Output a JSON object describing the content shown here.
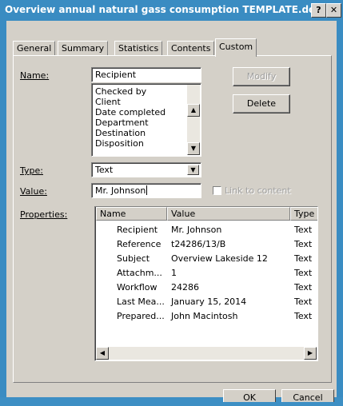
{
  "window": {
    "title": "Overview annual natural gass consumption TEMPLATE.do...",
    "help_glyph": "?",
    "close_glyph": "✕",
    "frame_color": "#3a8cc2"
  },
  "tabs": [
    "General",
    "Summary",
    "Statistics",
    "Contents",
    "Custom"
  ],
  "active_tab": "Custom",
  "form": {
    "name_label": "Name:",
    "name_value": "Recipient",
    "name_list": [
      "Checked by",
      "Client",
      "Date completed",
      "Department",
      "Destination",
      "Disposition"
    ],
    "type_label": "Type:",
    "type_value": "Text",
    "value_label": "Value:",
    "value_value": "Mr. Johnson",
    "link_label": "Link to content",
    "properties_label": "Properties:",
    "modify_button": "Modify",
    "delete_button": "Delete"
  },
  "properties": {
    "columns": [
      "Name",
      "Value",
      "Type"
    ],
    "rows": [
      {
        "name": "Recipient",
        "value": "Mr. Johnson",
        "type": "Text"
      },
      {
        "name": "Reference",
        "value": "t24286/13/B",
        "type": "Text"
      },
      {
        "name": "Subject",
        "value": "Overview Lakeside 12",
        "type": "Text"
      },
      {
        "name": "Attachm...",
        "value": "1",
        "type": "Text"
      },
      {
        "name": "Workflow",
        "value": "24286",
        "type": "Text"
      },
      {
        "name": "Last Mea...",
        "value": "January 15, 2014",
        "type": "Text"
      },
      {
        "name": "Prepared...",
        "value": "John Macintosh",
        "type": "Text"
      }
    ]
  },
  "footer": {
    "ok_button": "OK",
    "cancel_button": "Cancel"
  }
}
